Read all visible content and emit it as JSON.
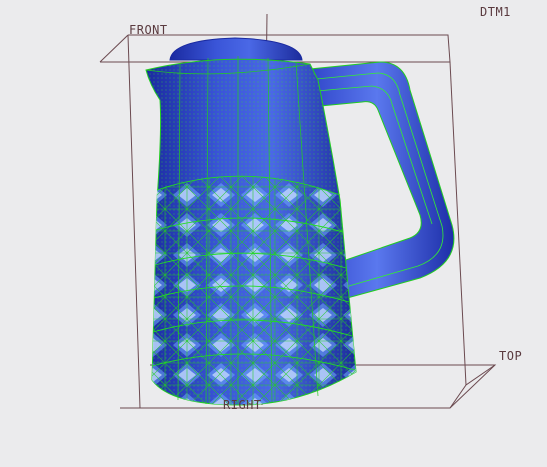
{
  "viewport": {
    "background": "#ebebed",
    "datum_color": "#5a3a3f",
    "model_color": "#2f45c8",
    "mesh_color": "#22cc22"
  },
  "datums": {
    "front": "FRONT",
    "dtm1": "DTM1",
    "top": "TOP",
    "right": "RIGHT"
  },
  "model": {
    "name": "kettle",
    "icon": "kettle-3d-model"
  }
}
